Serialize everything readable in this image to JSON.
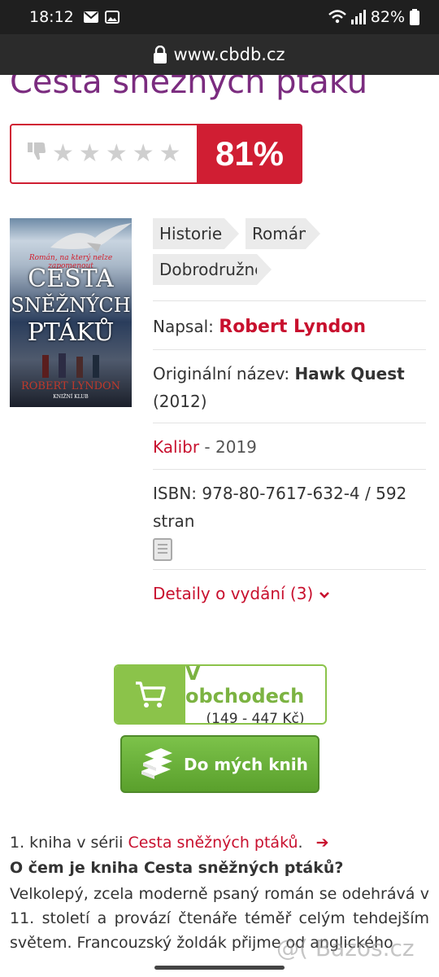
{
  "status_bar": {
    "time": "18:12",
    "battery": "82%"
  },
  "browser": {
    "url": "www.cbdb.cz"
  },
  "book": {
    "title": "Cesta sněžných ptáků",
    "rating_percent": "81%",
    "stars_total": 5,
    "cover": {
      "tagline": "Román, na který nelze zapomenout",
      "title_line1": "CESTA",
      "title_line2": "SNĚŽNÝCH",
      "title_line3": "PTÁKŮ",
      "author": "ROBERT LYNDON",
      "publisher": "KNIŽNÍ KLUB"
    },
    "genres": [
      "Historie",
      "Román",
      "Dobrodružné"
    ],
    "author_label": "Napsal:",
    "author": "Robert Lyndon",
    "original_title_label": "Originální název:",
    "original_title": "Hawk Quest",
    "original_year": "(2012)",
    "publisher": "Kalibr",
    "publish_year": "- 2019",
    "isbn_line1": "ISBN: 978-80-7617-632-4  /  592",
    "isbn_line2": "stran",
    "editions_link": "Detaily o vydání (3)"
  },
  "actions": {
    "shop_label": "V obchodech",
    "shop_price": "(149 - 447 Kč)",
    "my_books_label": "Do mých knih"
  },
  "series": {
    "prefix": "1. kniha v sérii",
    "name": "Cesta sněžných ptáků",
    "suffix": "."
  },
  "about": {
    "heading": "O čem je kniha Cesta sněžných ptáků?",
    "text": "Velkolepý, zcela moderně psaný román se odehrává v 11. století a provází čtenáře téměř celým tehdejším světem. Francouzský žoldák přijme od anglického"
  },
  "watermark": "@( Bazos.cz",
  "colors": {
    "brand_red": "#d01e33",
    "title_purple": "#7b2c7f",
    "green": "#8bc34a"
  }
}
